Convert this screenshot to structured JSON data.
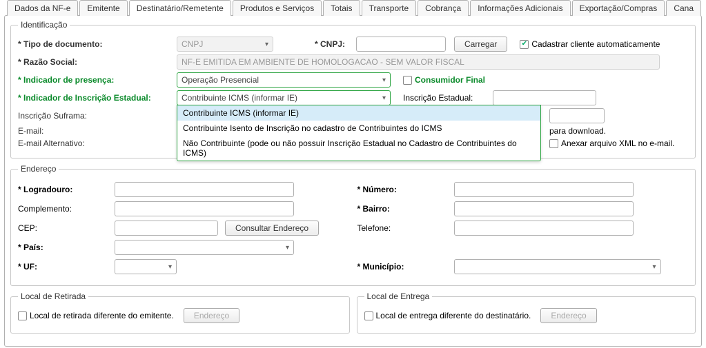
{
  "tabs": [
    "Dados da NF-e",
    "Emitente",
    "Destinatário/Remetente",
    "Produtos e Serviços",
    "Totais",
    "Transporte",
    "Cobrança",
    "Informações Adicionais",
    "Exportação/Compras",
    "Cana"
  ],
  "activeTab": 2,
  "ident": {
    "legend": "Identificação",
    "tipo_doc_label": "* Tipo de documento:",
    "tipo_doc_value": "CNPJ",
    "cnpj_label": "* CNPJ:",
    "cnpj_value": "",
    "carregar": "Carregar",
    "auto_label": "Cadastrar cliente automaticamente",
    "auto_checked": true,
    "razao_label": "* Razão Social:",
    "razao_value": "NF-E EMITIDA EM AMBIENTE DE HOMOLOGACAO - SEM VALOR FISCAL",
    "presenca_label": "* Indicador de presença:",
    "presenca_value": "Operação Presencial",
    "cons_final_label": "Consumidor Final",
    "cons_final_checked": false,
    "iie_label": "* Indicador de Inscrição Estadual:",
    "iie_value": "Contribuinte ICMS (informar IE)",
    "ie_label": "Inscrição Estadual:",
    "ie_value": "",
    "iie_options": [
      "Contribuinte ICMS (informar IE)",
      "Contribuinte Isento de Inscrição no cadastro de Contribuintes do ICMS",
      "Não Contribuinte (pode ou não possuir Inscrição Estadual no Cadastro de Contribuintes do ICMS)"
    ],
    "suframa_label": "Inscrição Suframa:",
    "email_label": "E-mail:",
    "email_hint": "para download.",
    "email_alt_label": "E-mail Alternativo:",
    "anexo_label": "Anexar arquivo XML no e-mail.",
    "anexo_checked": false
  },
  "end": {
    "legend": "Endereço",
    "logradouro_label": "* Logradouro:",
    "numero_label": "* Número:",
    "complemento_label": "Complemento:",
    "bairro_label": "* Bairro:",
    "cep_label": "CEP:",
    "consultar": "Consultar Endereço",
    "telefone_label": "Telefone:",
    "pais_label": "* País:",
    "uf_label": "* UF:",
    "municipio_label": "* Município:"
  },
  "retirada": {
    "legend": "Local de Retirada",
    "chk_label": "Local de retirada diferente do emitente.",
    "btn": "Endereço"
  },
  "entrega": {
    "legend": "Local de Entrega",
    "chk_label": "Local de entrega diferente do destinatário.",
    "btn": "Endereço"
  }
}
